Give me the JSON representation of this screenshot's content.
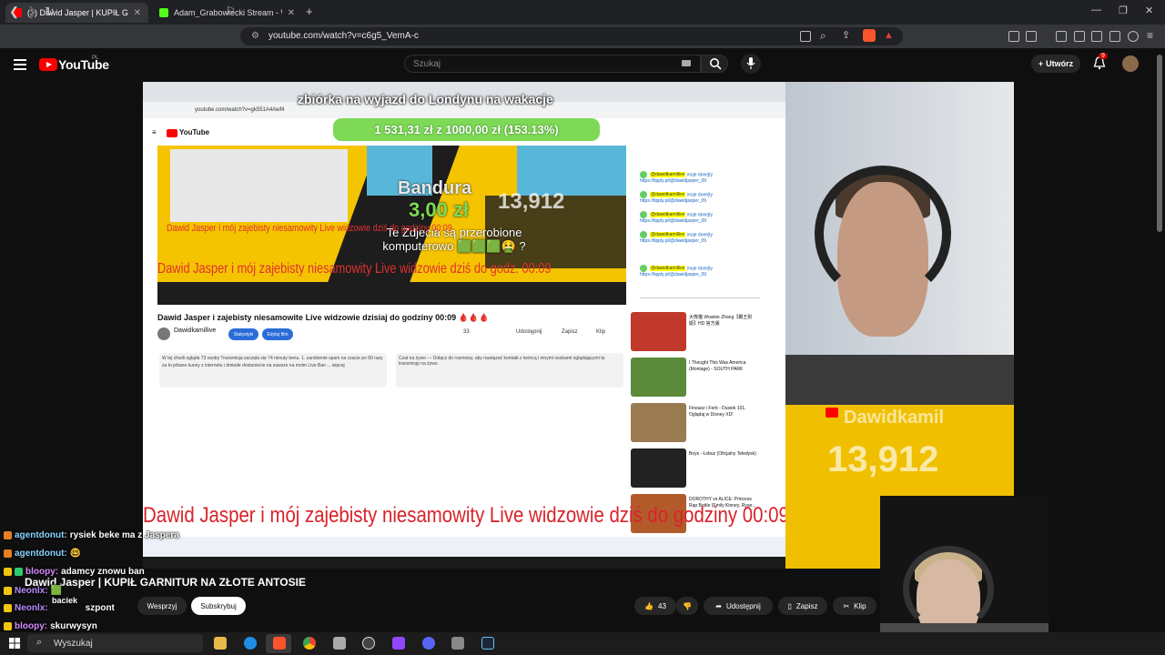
{
  "browser": {
    "tabs": [
      {
        "label": "(3) Dawid Jasper | KUPIŁ GAR",
        "active": true,
        "color": "#ff0000"
      },
      {
        "label": "Adam_Grabowiecki Stream - Watch L",
        "active": false,
        "color": "#53fc18"
      }
    ],
    "url": "youtube.com/watch?v=c6g5_VemA-c"
  },
  "youtube": {
    "logo_text": "YouTube",
    "region": "PL",
    "search_placeholder": "Szukaj",
    "create_label": "Utwórz",
    "notifications_count": "9"
  },
  "video": {
    "caption_top": "zbiórka na wyjazd do Londynu na wakacje",
    "goal_text": "1 531,31 zł z 1000,00 zł (153.13%)",
    "donor": "Bandura",
    "donation_amount": "3,00 zł",
    "donation_message": "Te Zdjecia są przerobione komputerowo 🟩🟩🟩🤮 ?",
    "viewer_count": "13,912",
    "red_title_small": "Dawid Jasper i mój zajebisty niesamowity Live widzowie dziś do godziny 00:09",
    "red_title_mid": "Dawid Jasper i mój zajebisty niesamowity Live widzowie dziś do godz. 00:09",
    "inner_title": "Dawid Jasper i zajebisty niesamowite Live widzowie dzisiaj do godziny 00:09 🩸🩸🩸",
    "inner_channel": "Dawidkamillive",
    "inner_buttons": [
      "Statystyki",
      "Edytuj film"
    ],
    "inner_actions": [
      "33",
      "Udostępnij",
      "Zapisz",
      "Klip"
    ],
    "inner_desc": "W tej chwili ogląda 73 osoby  Transmisja zaczęła się 74 minuty temu. 1. zarobienie spam na czacie po 60 razy za to jebane kurwy z internetu i dmiede dostaniecie na zawsze na moim Live Ban ... więcej",
    "inner_chat_box": "Czat na żywo — Dołącz do rozmowy, aby nawiązać kontakt z twórcą i innymi osobami oglądającymi tę transmisję na żywo.",
    "chat_name": "@dawidkamillive",
    "chat_text": "moje donejty https://tipply.pl/@dawidjasper_09",
    "recommendations": [
      {
        "title": "大熊猫 Wowkie Zhang【霸王别姬】HD 官方版",
        "color": "#c0392b"
      },
      {
        "title": "I Thought This Was America (Montage) - SOUTH PARK",
        "color": "#5a8a3a"
      },
      {
        "title": "Fineasz i Ferb - Dusiek 101. Oglądaj w Disney XD!",
        "color": "#9a7b52"
      },
      {
        "title": "Boys - Łobuz (Oficjalny Teledysk)",
        "color": "#222222"
      },
      {
        "title": "DOROTHY vs ALICE: Princess Rap Battle (Emily Kinney, Ryan...",
        "color": "#b35a2b"
      }
    ],
    "big_lower_title": "Dawid Jasper i mój zajebisty niesamowity Live widzowie dziś do godziny 00:09",
    "webcam_label": "BACIEK",
    "overlay_channel": "Dawidkamil"
  },
  "chat": [
    {
      "user": "agentdonut:",
      "text": "rysiek beke ma z Jaspera",
      "color": "#8ad3ff"
    },
    {
      "user": "agentdonut:",
      "text": "🤓",
      "color": "#8ad3ff"
    },
    {
      "user": "bloopy:",
      "text": "adamcy znowu ban",
      "color": "#d58cff"
    },
    {
      "user": "Neonlx:",
      "text": "🟩",
      "color": "#b98cff"
    },
    {
      "user": "Neonlx:",
      "text": "szpont",
      "color": "#b98cff"
    },
    {
      "user": "bloopy:",
      "text": "skurwysyn",
      "color": "#d58cff"
    }
  ],
  "page": {
    "title": "Dawid Jasper | KUPIŁ GARNITUR NA ZŁOTE ANTOSIE",
    "channel": "baciek",
    "support_label": "Wesprzyj",
    "subscribe_label": "Subskrybuj",
    "likes": "43",
    "share_label": "Udostępnij",
    "save_label": "Zapisz",
    "clip_label": "Klip"
  },
  "taskbar": {
    "search_placeholder": "Wyszukaj"
  }
}
